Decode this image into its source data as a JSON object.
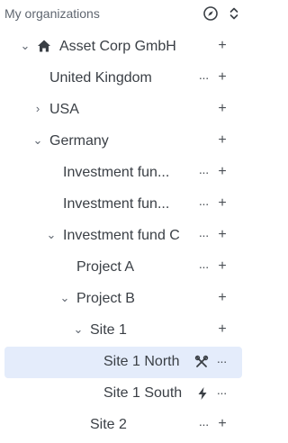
{
  "header": {
    "title": "My organizations",
    "compass_icon": "compass-icon",
    "sort_icon": "chevron-up-down-icon"
  },
  "tree": {
    "rows": [
      {
        "label": "Asset Corp GmbH"
      },
      {
        "label": "United Kingdom"
      },
      {
        "label": "USA"
      },
      {
        "label": "Germany"
      },
      {
        "label": "Investment fun..."
      },
      {
        "label": "Investment fun..."
      },
      {
        "label": "Investment fund C"
      },
      {
        "label": "Project A"
      },
      {
        "label": "Project B"
      },
      {
        "label": "Site 1"
      },
      {
        "label": "Site 1 North"
      },
      {
        "label": "Site 1 South"
      },
      {
        "label": "Site 2"
      }
    ]
  },
  "colors": {
    "selected_bg": "#e4ecfb",
    "text": "#3a3f45",
    "muted": "#5f6670"
  }
}
